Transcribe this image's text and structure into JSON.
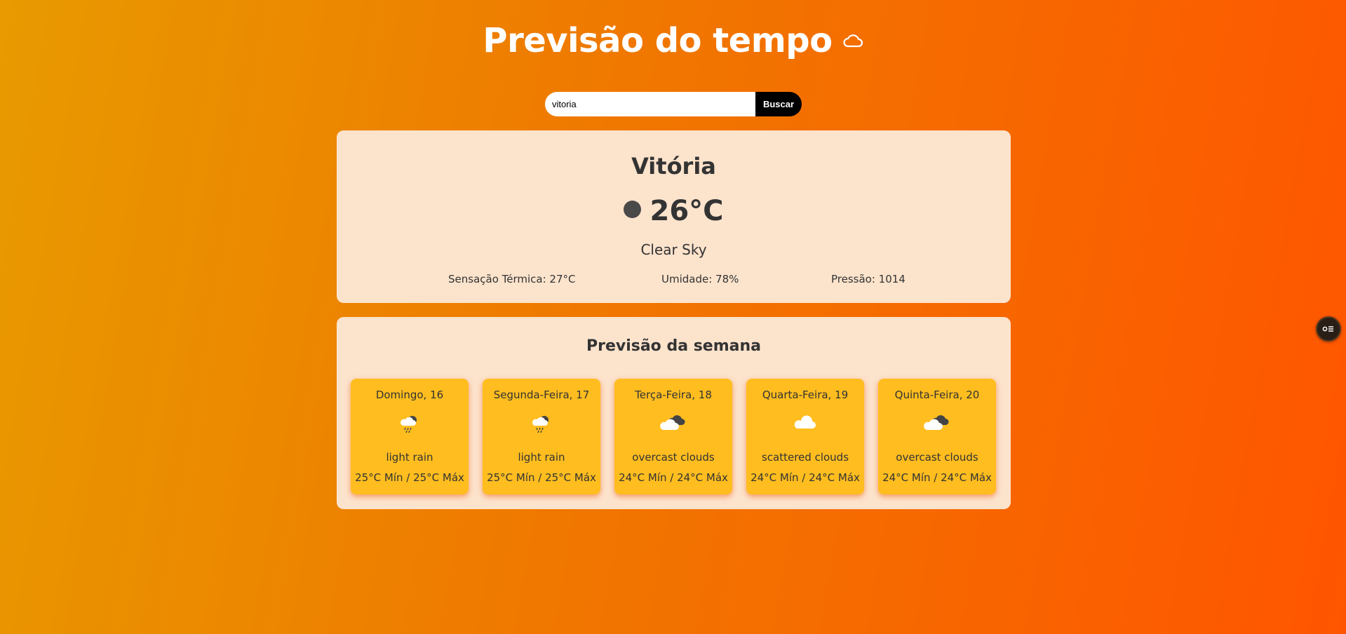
{
  "header": {
    "title": "Previsão do tempo",
    "icon": "cloud-outline-icon"
  },
  "search": {
    "value": "vitoria",
    "button_label": "Buscar"
  },
  "current": {
    "city": "Vitória",
    "icon": "dark-circle-icon",
    "temperature": "26°C",
    "condition": "Clear Sky",
    "feels_like": "Sensação Térmica: 27°C",
    "humidity": "Umidade: 78%",
    "pressure": "Pressão: 1014"
  },
  "forecast": {
    "title": "Previsão da semana",
    "days": [
      {
        "name": "Domingo, 16",
        "icon": "rain-icon",
        "description": "light rain",
        "temps": "25°C Mín / 25°C Máx"
      },
      {
        "name": "Segunda-Feira, 17",
        "icon": "rain-icon",
        "description": "light rain",
        "temps": "25°C Mín / 25°C Máx"
      },
      {
        "name": "Terça-Feira, 18",
        "icon": "overcast-clouds-icon",
        "description": "overcast clouds",
        "temps": "24°C Mín / 24°C Máx"
      },
      {
        "name": "Quarta-Feira, 19",
        "icon": "scattered-clouds-icon",
        "description": "scattered clouds",
        "temps": "24°C Mín / 24°C Máx"
      },
      {
        "name": "Quinta-Feira, 20",
        "icon": "overcast-clouds-icon",
        "description": "overcast clouds",
        "temps": "24°C Mín / 24°C Máx"
      }
    ]
  },
  "floating_button": {
    "icon": "extension-toggle-icon"
  },
  "colors": {
    "card_background": "#fce3cc",
    "day_card_background": "#ffbd1f",
    "search_button": "#000000"
  }
}
